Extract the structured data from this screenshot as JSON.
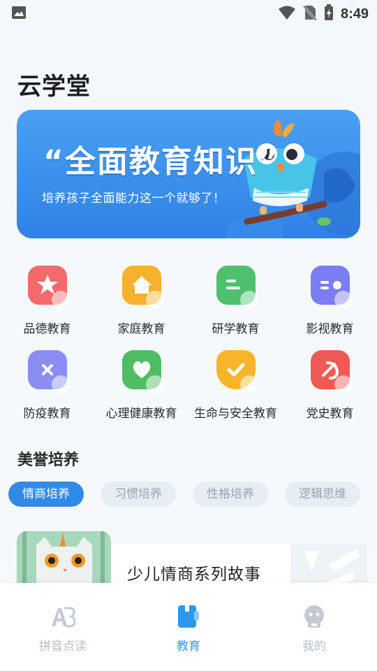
{
  "status_bar": {
    "time": "8:49"
  },
  "app": {
    "title": "云学堂"
  },
  "banner": {
    "headline": "“全面教育知识”",
    "subtitle": "培养孩子全面能力这一个就够了！"
  },
  "categories": [
    {
      "label": "品德教育",
      "icon": "star-icon",
      "color": "#f46a6a"
    },
    {
      "label": "家庭教育",
      "icon": "house-icon",
      "color": "#f7b12c"
    },
    {
      "label": "研学教育",
      "icon": "book-icon",
      "color": "#4fc06b"
    },
    {
      "label": "影视教育",
      "icon": "video-icon",
      "color": "#7a7ef2"
    },
    {
      "label": "防疫教育",
      "icon": "mask-icon",
      "color": "#8a8ef3"
    },
    {
      "label": "心理健康教育",
      "icon": "heart-icon",
      "color": "#4fbd64"
    },
    {
      "label": "生命与安全教育",
      "icon": "shield-icon",
      "color": "#f8b52c"
    },
    {
      "label": "党史教育",
      "icon": "party-emblem-icon",
      "color": "#f05a55"
    }
  ],
  "section": {
    "title": "美誉培养"
  },
  "tabs": [
    {
      "label": "情商培养",
      "active": true
    },
    {
      "label": "习惯培养",
      "active": false
    },
    {
      "label": "性格培养",
      "active": false
    },
    {
      "label": "逻辑思维",
      "active": false
    }
  ],
  "feature_card": {
    "title": "少儿情商系列故事"
  },
  "bottom_nav": [
    {
      "label": "拼音点读",
      "icon": "ab-letters-icon",
      "active": false
    },
    {
      "label": "教育",
      "icon": "notebook-icon",
      "active": true
    },
    {
      "label": "我的",
      "icon": "profile-icon",
      "active": false
    }
  ]
}
